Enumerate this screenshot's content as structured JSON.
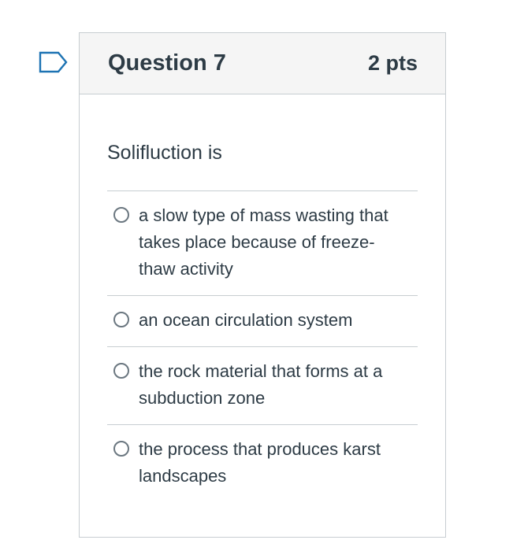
{
  "flag": {
    "icon": "bookmark-flag-icon",
    "color": "#0770a3"
  },
  "question": {
    "title": "Question 7",
    "points": "2 pts",
    "text": "Solifluction is"
  },
  "answers": [
    {
      "label": "a slow type of mass wasting that takes place because of freeze-thaw activity",
      "selected": false
    },
    {
      "label": "an ocean circulation system",
      "selected": false
    },
    {
      "label": "the rock material that forms at a subduction zone",
      "selected": false
    },
    {
      "label": "the process that produces karst landscapes",
      "selected": false
    }
  ]
}
